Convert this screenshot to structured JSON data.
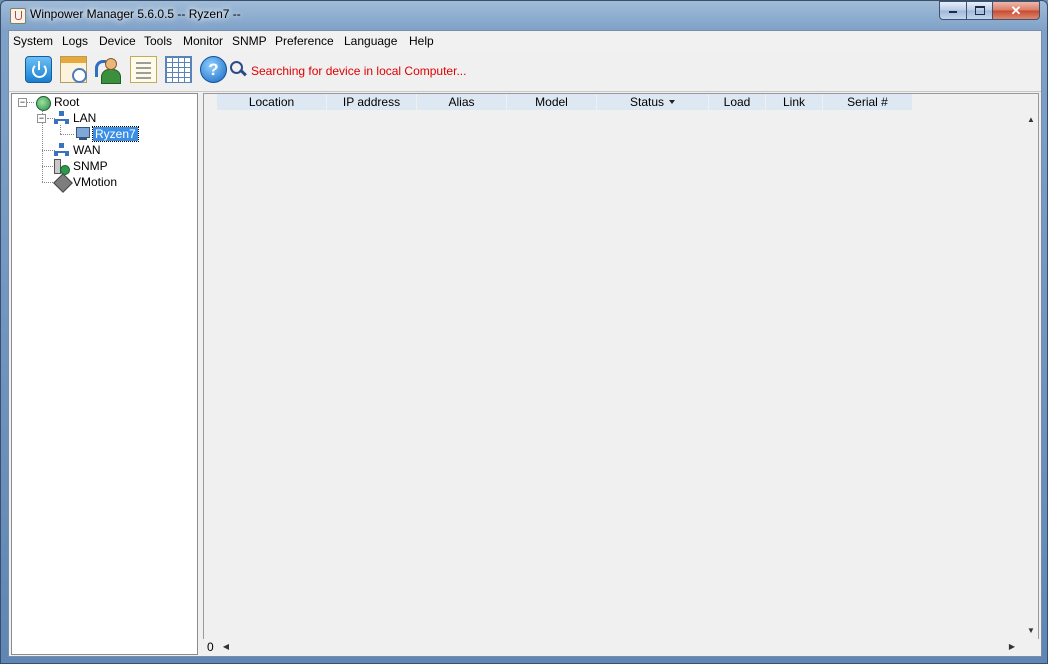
{
  "window": {
    "title": "Winpower Manager 5.6.0.5 -- Ryzen7 --",
    "close_label": "✕"
  },
  "menu": {
    "items": [
      {
        "label": "System"
      },
      {
        "label": "Logs"
      },
      {
        "label": "Device"
      },
      {
        "label": "Tools"
      },
      {
        "label": "Monitor"
      },
      {
        "label": "SNMP"
      },
      {
        "label": "Preference"
      },
      {
        "label": "Language"
      },
      {
        "label": "Help"
      }
    ]
  },
  "toolbar": {
    "icons": [
      "power-icon",
      "calendar-clock-icon",
      "user-refresh-icon",
      "list-icon",
      "grid-icon",
      "help-icon"
    ],
    "help_glyph": "?",
    "status_message": "Searching for device in local Computer...",
    "status_color": "#e00000"
  },
  "tree": {
    "root": "Root",
    "lan": "LAN",
    "lan_child": "Ryzen7",
    "wan": "WAN",
    "snmp": "SNMP",
    "vmotion": "VMotion",
    "expander_glyph": "−"
  },
  "table": {
    "columns": [
      {
        "label": "Location"
      },
      {
        "label": "IP address"
      },
      {
        "label": "Alias"
      },
      {
        "label": "Model"
      },
      {
        "label": "Status",
        "sorted": true
      },
      {
        "label": "Load"
      },
      {
        "label": "Link"
      },
      {
        "label": "Serial #"
      }
    ],
    "rows": [],
    "row_count": "0",
    "header_color": "#dde8f3"
  },
  "scroll": {
    "up": "▲",
    "down": "▼",
    "left": "◀",
    "right": "▶"
  }
}
